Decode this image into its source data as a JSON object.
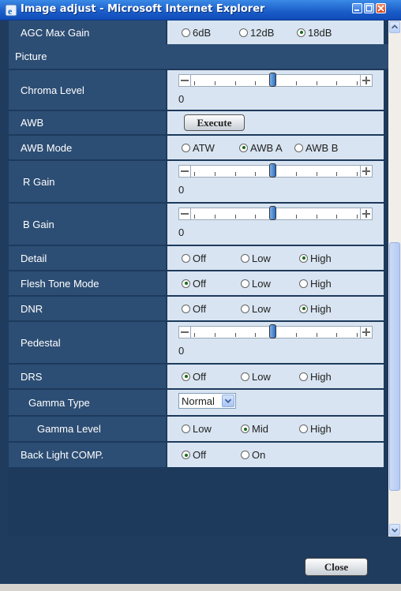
{
  "window": {
    "title": "Image adjust - Microsoft Internet Explorer"
  },
  "rows": {
    "agc": {
      "label": "AGC Max Gain",
      "options": [
        "6dB",
        "12dB",
        "18dB"
      ],
      "selected": "18dB"
    },
    "picture": {
      "label": "Picture"
    },
    "chroma": {
      "label": "Chroma Level",
      "value": "0"
    },
    "awb": {
      "label": "AWB",
      "button": "Execute"
    },
    "awb_mode": {
      "label": "AWB Mode",
      "options": [
        "ATW",
        "AWB A",
        "AWB B"
      ],
      "selected": "AWB A"
    },
    "r_gain": {
      "label": "R Gain",
      "value": "0"
    },
    "b_gain": {
      "label": "B Gain",
      "value": "0"
    },
    "detail": {
      "label": "Detail",
      "options": [
        "Off",
        "Low",
        "High"
      ],
      "selected": "High"
    },
    "flesh": {
      "label": "Flesh Tone Mode",
      "options": [
        "Off",
        "Low",
        "High"
      ],
      "selected": "Off"
    },
    "dnr": {
      "label": "DNR",
      "options": [
        "Off",
        "Low",
        "High"
      ],
      "selected": "High"
    },
    "pedestal": {
      "label": "Pedestal",
      "value": "0"
    },
    "drs": {
      "label": "DRS",
      "options": [
        "Off",
        "Low",
        "High"
      ],
      "selected": "Off"
    },
    "gamma_type": {
      "label": "Gamma Type",
      "selected": "Normal"
    },
    "gamma_level": {
      "label": "Gamma Level",
      "options": [
        "Low",
        "Mid",
        "High"
      ],
      "selected": "Mid"
    },
    "backlight": {
      "label": "Back Light COMP.",
      "options": [
        "Off",
        "On"
      ],
      "selected": "Off"
    }
  },
  "footer": {
    "close_label": "Close"
  },
  "colors": {
    "panel_bg": "#1d3a5c",
    "label_bg": "#2d4e74",
    "value_bg": "#d8e4f1",
    "titlebar": "#1a5cc8"
  },
  "icons": {
    "window_icon": "ie-icon",
    "scroll_up": "scroll-up-icon",
    "scroll_down": "scroll-down-icon"
  }
}
